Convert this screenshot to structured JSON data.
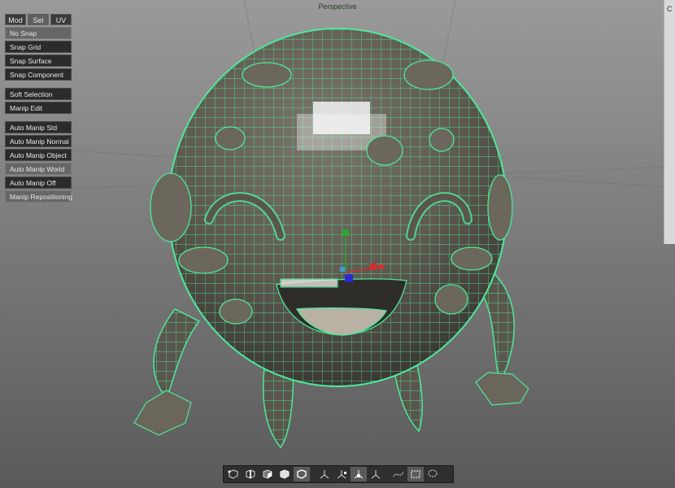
{
  "viewport": {
    "title": "Perspective"
  },
  "panel": {
    "tabs": [
      {
        "label": "Mod"
      },
      {
        "label": "Sel",
        "active": true
      },
      {
        "label": "UV"
      }
    ],
    "snap_buttons": [
      {
        "label": "No Snap",
        "highlighted": true
      },
      {
        "label": "Snap Grid"
      },
      {
        "label": "Snap Surface"
      },
      {
        "label": "Snap Component"
      }
    ],
    "edit_buttons": [
      {
        "label": "Soft Selection"
      },
      {
        "label": "Manip Edit"
      }
    ],
    "manip_buttons": [
      {
        "label": "Auto Manip Std"
      },
      {
        "label": "Auto Manip Normal"
      },
      {
        "label": "Auto Manip Object"
      },
      {
        "label": "Auto Manip World",
        "highlighted": true
      },
      {
        "label": "Auto Manip Off"
      },
      {
        "label": "Manip Repositioning",
        "highlighted": true
      }
    ]
  },
  "right_stub": {
    "label": "C"
  },
  "toolbar": {
    "groups": [
      [
        "vertex-mode-icon",
        "edge-mode-icon",
        "face-mode-icon",
        "object-mode-icon",
        "shaded-mode-icon"
      ],
      [
        "move-axis-icon",
        "rotate-axis-icon",
        "scale-axis-icon",
        "transform-axis-icon"
      ],
      [
        "curve-select-icon",
        "marquee-select-icon",
        "lasso-select-icon"
      ]
    ],
    "selected": [
      "shaded-mode-icon",
      "scale-axis-icon",
      "marquee-select-icon"
    ]
  },
  "colors": {
    "wireframe": "#4fe89a",
    "mesh_shade": "#5e5a52",
    "panel_bg": "#2b2b2b",
    "button_highlight": "#666666"
  }
}
